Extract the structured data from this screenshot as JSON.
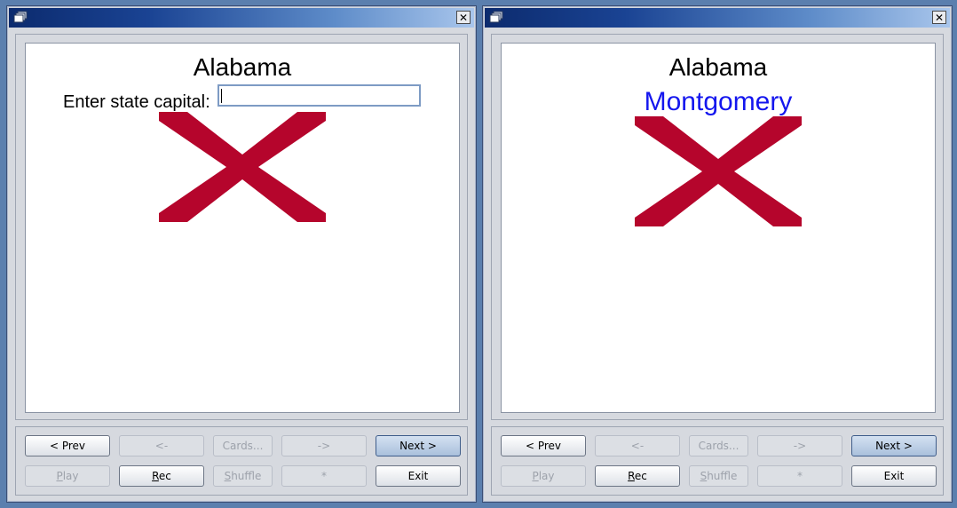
{
  "windows": [
    {
      "card": {
        "state": "Alabama",
        "prompt_label": "Enter state capital:",
        "answer_value": ""
      },
      "buttons": {
        "prev": "< Prev",
        "back": "<-",
        "cards": "Cards...",
        "forward": "->",
        "next": "Next >",
        "play": "Play",
        "rec": "Rec",
        "shuffle": "Shuffle",
        "star": "*",
        "exit": "Exit"
      }
    },
    {
      "card": {
        "state": "Alabama",
        "capital": "Montgomery"
      },
      "buttons": {
        "prev": "< Prev",
        "back": "<-",
        "cards": "Cards...",
        "forward": "->",
        "next": "Next >",
        "play": "Play",
        "rec": "Rec",
        "shuffle": "Shuffle",
        "star": "*",
        "exit": "Exit"
      }
    }
  ],
  "colors": {
    "flag_cross": "#b5052c",
    "answer_text": "#1416ee",
    "titlebar_start": "#0c2b6e",
    "titlebar_end": "#a9c6ec"
  },
  "icons": {
    "window_icon": "app-window-icon",
    "close": "close-icon",
    "flag": "alabama-flag"
  }
}
